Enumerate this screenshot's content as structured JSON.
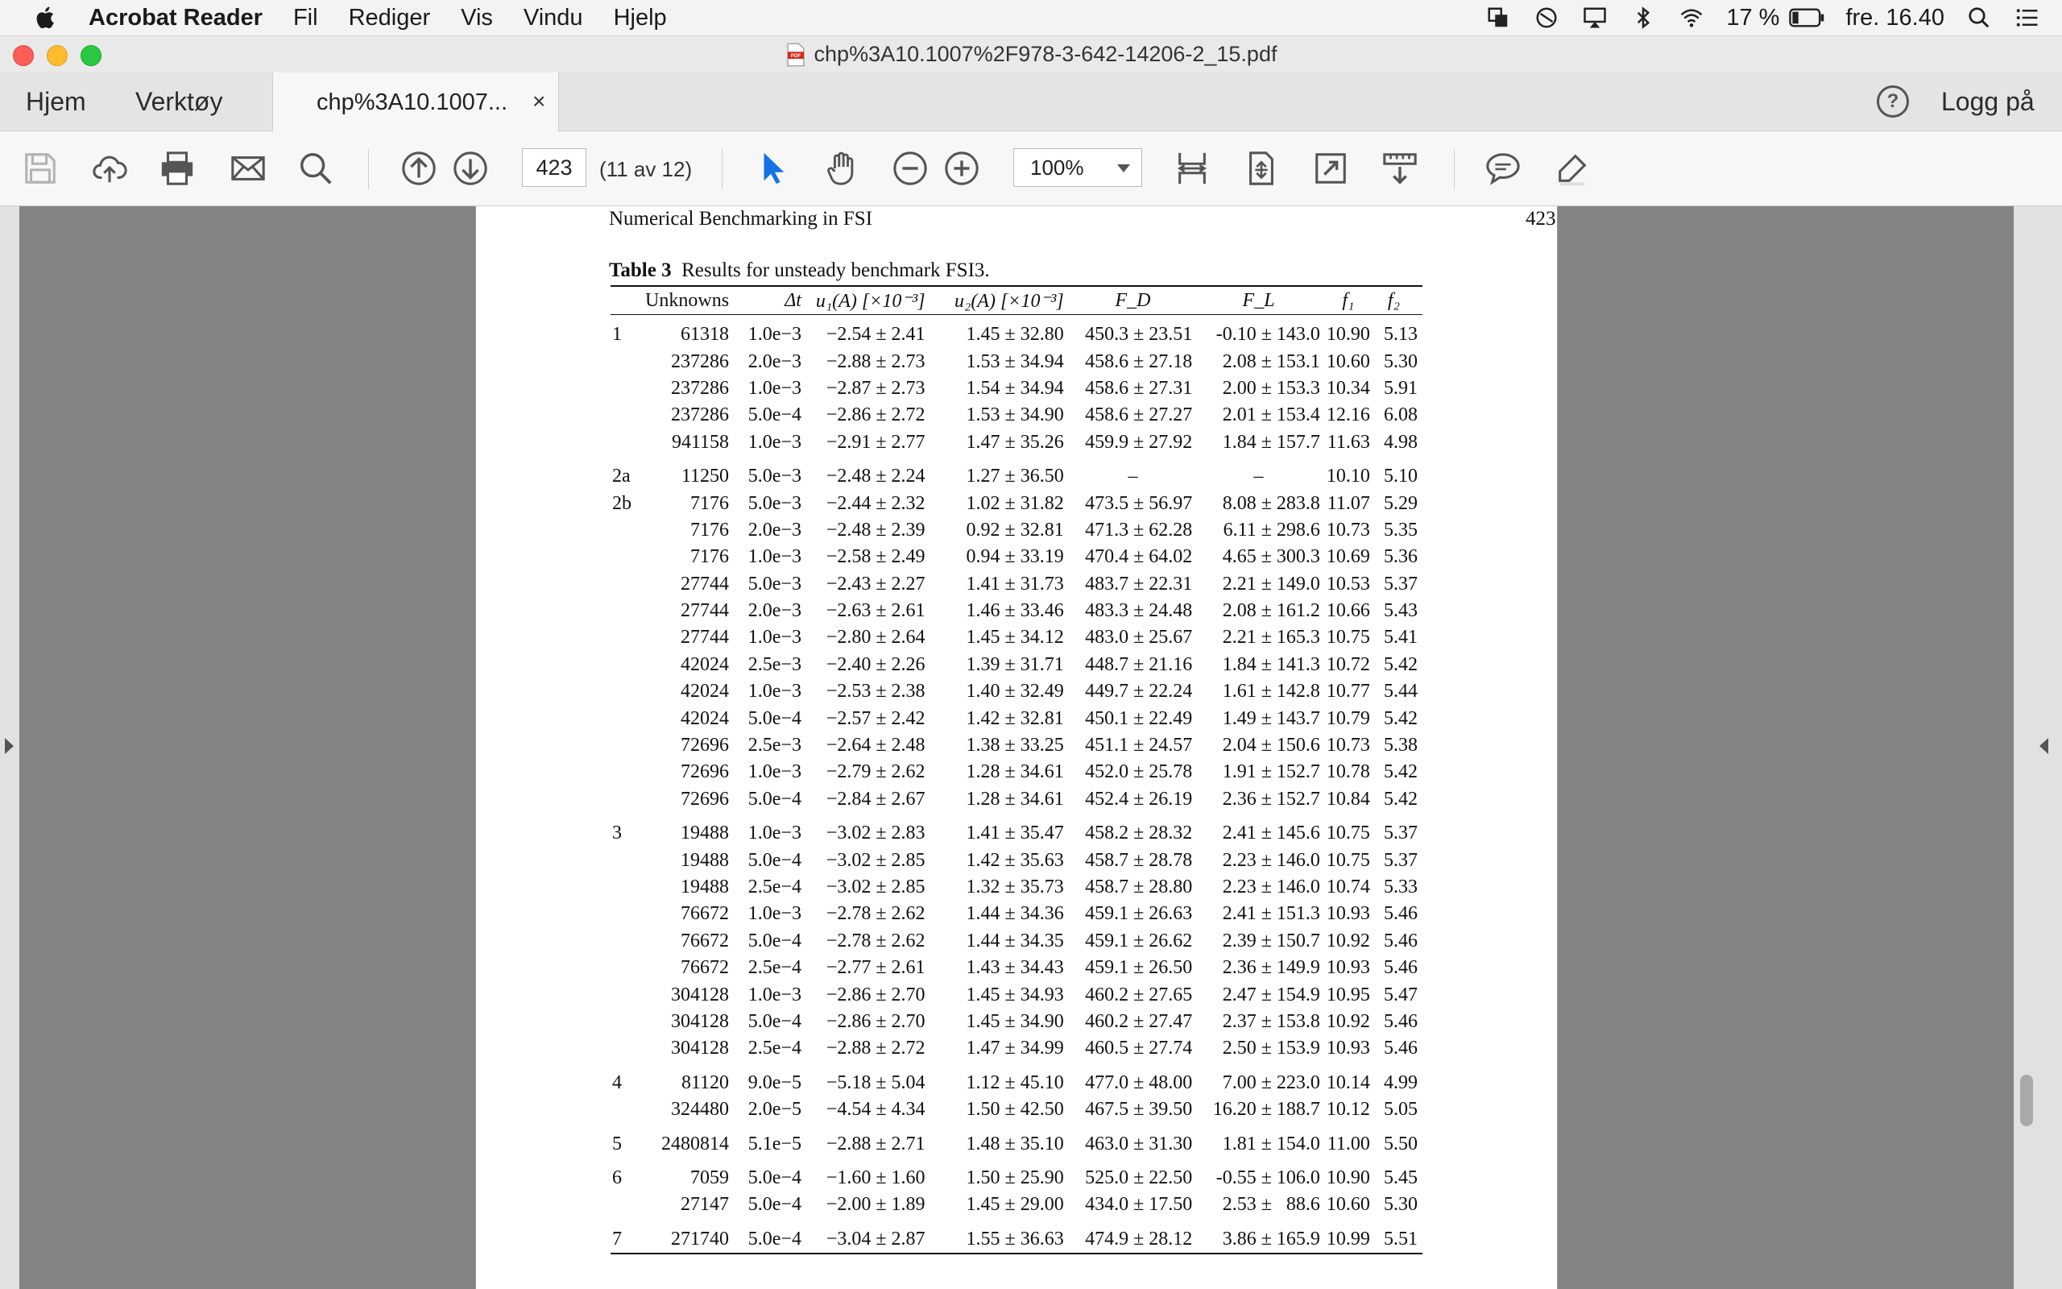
{
  "menubar": {
    "app_name": "Acrobat Reader",
    "menus": [
      "Fil",
      "Rediger",
      "Vis",
      "Vindu",
      "Hjelp"
    ],
    "battery": "17 %",
    "clock": "fre. 16.40"
  },
  "window": {
    "title": "chp%3A10.1007%2F978-3-642-14206-2_15.pdf"
  },
  "tabs": {
    "home": "Hjem",
    "tools": "Verktøy",
    "document": "chp%3A10.1007...",
    "close": "×",
    "help": "?",
    "login": "Logg på"
  },
  "toolbar": {
    "page_number": "423",
    "page_of": "(11 av 12)",
    "zoom": "100%"
  },
  "document": {
    "running_title": "Numerical Benchmarking in FSI",
    "page_number": "423",
    "caption_label": "Table 3",
    "caption_text": "Results for unsteady benchmark FSI3.",
    "headers": {
      "unknowns": "Unknowns",
      "dt": "Δt",
      "u1": "u₁(A) [×10⁻³]",
      "u2": "u₂(A) [×10⁻³]",
      "fd": "F_D",
      "fl": "F_L",
      "f1": "f₁",
      "f2": "f₂"
    },
    "groups": [
      {
        "rows": [
          [
            "1",
            "61318",
            "1.0e−3",
            "−2.54 ± 2.41",
            "1.45 ± 32.80",
            "450.3 ± 23.51",
            "-0.10 ± 143.0",
            "10.90",
            "5.13"
          ],
          [
            "",
            "237286",
            "2.0e−3",
            "−2.88 ± 2.73",
            "1.53 ± 34.94",
            "458.6 ± 27.18",
            "2.08 ± 153.1",
            "10.60",
            "5.30"
          ],
          [
            "",
            "237286",
            "1.0e−3",
            "−2.87 ± 2.73",
            "1.54 ± 34.94",
            "458.6 ± 27.31",
            "2.00 ± 153.3",
            "10.34",
            "5.91"
          ],
          [
            "",
            "237286",
            "5.0e−4",
            "−2.86 ± 2.72",
            "1.53 ± 34.90",
            "458.6 ± 27.27",
            "2.01 ± 153.4",
            "12.16",
            "6.08"
          ],
          [
            "",
            "941158",
            "1.0e−3",
            "−2.91 ± 2.77",
            "1.47 ± 35.26",
            "459.9 ± 27.92",
            "1.84 ± 157.7",
            "11.63",
            "4.98"
          ]
        ]
      },
      {
        "rows": [
          [
            "2a",
            "11250",
            "5.0e−3",
            "−2.48 ± 2.24",
            "1.27 ± 36.50",
            "–",
            "–",
            "10.10",
            "5.10"
          ],
          [
            "2b",
            "7176",
            "5.0e−3",
            "−2.44 ± 2.32",
            "1.02 ± 31.82",
            "473.5 ± 56.97",
            "8.08 ± 283.8",
            "11.07",
            "5.29"
          ],
          [
            "",
            "7176",
            "2.0e−3",
            "−2.48 ± 2.39",
            "0.92 ± 32.81",
            "471.3 ± 62.28",
            "6.11 ± 298.6",
            "10.73",
            "5.35"
          ],
          [
            "",
            "7176",
            "1.0e−3",
            "−2.58 ± 2.49",
            "0.94 ± 33.19",
            "470.4 ± 64.02",
            "4.65 ± 300.3",
            "10.69",
            "5.36"
          ],
          [
            "",
            "27744",
            "5.0e−3",
            "−2.43 ± 2.27",
            "1.41 ± 31.73",
            "483.7 ± 22.31",
            "2.21 ± 149.0",
            "10.53",
            "5.37"
          ],
          [
            "",
            "27744",
            "2.0e−3",
            "−2.63 ± 2.61",
            "1.46 ± 33.46",
            "483.3 ± 24.48",
            "2.08 ± 161.2",
            "10.66",
            "5.43"
          ],
          [
            "",
            "27744",
            "1.0e−3",
            "−2.80 ± 2.64",
            "1.45 ± 34.12",
            "483.0 ± 25.67",
            "2.21 ± 165.3",
            "10.75",
            "5.41"
          ],
          [
            "",
            "42024",
            "2.5e−3",
            "−2.40 ± 2.26",
            "1.39 ± 31.71",
            "448.7 ± 21.16",
            "1.84 ± 141.3",
            "10.72",
            "5.42"
          ],
          [
            "",
            "42024",
            "1.0e−3",
            "−2.53 ± 2.38",
            "1.40 ± 32.49",
            "449.7 ± 22.24",
            "1.61 ± 142.8",
            "10.77",
            "5.44"
          ],
          [
            "",
            "42024",
            "5.0e−4",
            "−2.57 ± 2.42",
            "1.42 ± 32.81",
            "450.1 ± 22.49",
            "1.49 ± 143.7",
            "10.79",
            "5.42"
          ],
          [
            "",
            "72696",
            "2.5e−3",
            "−2.64 ± 2.48",
            "1.38 ± 33.25",
            "451.1 ± 24.57",
            "2.04 ± 150.6",
            "10.73",
            "5.38"
          ],
          [
            "",
            "72696",
            "1.0e−3",
            "−2.79 ± 2.62",
            "1.28 ± 34.61",
            "452.0 ± 25.78",
            "1.91 ± 152.7",
            "10.78",
            "5.42"
          ],
          [
            "",
            "72696",
            "5.0e−4",
            "−2.84 ± 2.67",
            "1.28 ± 34.61",
            "452.4 ± 26.19",
            "2.36 ± 152.7",
            "10.84",
            "5.42"
          ]
        ]
      },
      {
        "rows": [
          [
            "3",
            "19488",
            "1.0e−3",
            "−3.02 ± 2.83",
            "1.41 ± 35.47",
            "458.2 ± 28.32",
            "2.41 ± 145.6",
            "10.75",
            "5.37"
          ],
          [
            "",
            "19488",
            "5.0e−4",
            "−3.02 ± 2.85",
            "1.42 ± 35.63",
            "458.7 ± 28.78",
            "2.23 ± 146.0",
            "10.75",
            "5.37"
          ],
          [
            "",
            "19488",
            "2.5e−4",
            "−3.02 ± 2.85",
            "1.32 ± 35.73",
            "458.7 ± 28.80",
            "2.23 ± 146.0",
            "10.74",
            "5.33"
          ],
          [
            "",
            "76672",
            "1.0e−3",
            "−2.78 ± 2.62",
            "1.44 ± 34.36",
            "459.1 ± 26.63",
            "2.41 ± 151.3",
            "10.93",
            "5.46"
          ],
          [
            "",
            "76672",
            "5.0e−4",
            "−2.78 ± 2.62",
            "1.44 ± 34.35",
            "459.1 ± 26.62",
            "2.39 ± 150.7",
            "10.92",
            "5.46"
          ],
          [
            "",
            "76672",
            "2.5e−4",
            "−2.77 ± 2.61",
            "1.43 ± 34.43",
            "459.1 ± 26.50",
            "2.36 ± 149.9",
            "10.93",
            "5.46"
          ],
          [
            "",
            "304128",
            "1.0e−3",
            "−2.86 ± 2.70",
            "1.45 ± 34.93",
            "460.2 ± 27.65",
            "2.47 ± 154.9",
            "10.95",
            "5.47"
          ],
          [
            "",
            "304128",
            "5.0e−4",
            "−2.86 ± 2.70",
            "1.45 ± 34.90",
            "460.2 ± 27.47",
            "2.37 ± 153.8",
            "10.92",
            "5.46"
          ],
          [
            "",
            "304128",
            "2.5e−4",
            "−2.88 ± 2.72",
            "1.47 ± 34.99",
            "460.5 ± 27.74",
            "2.50 ± 153.9",
            "10.93",
            "5.46"
          ]
        ]
      },
      {
        "rows": [
          [
            "4",
            "81120",
            "9.0e−5",
            "−5.18 ± 5.04",
            "1.12 ± 45.10",
            "477.0 ± 48.00",
            "7.00 ± 223.0",
            "10.14",
            "4.99"
          ],
          [
            "",
            "324480",
            "2.0e−5",
            "−4.54 ± 4.34",
            "1.50 ± 42.50",
            "467.5 ± 39.50",
            "16.20 ± 188.7",
            "10.12",
            "5.05"
          ]
        ]
      },
      {
        "rows": [
          [
            "5",
            "2480814",
            "5.1e−5",
            "−2.88 ± 2.71",
            "1.48 ± 35.10",
            "463.0 ± 31.30",
            "1.81 ± 154.0",
            "11.00",
            "5.50"
          ]
        ]
      },
      {
        "rows": [
          [
            "6",
            "7059",
            "5.0e−4",
            "−1.60 ± 1.60",
            "1.50 ± 25.90",
            "525.0 ± 22.50",
            "-0.55 ± 106.0",
            "10.90",
            "5.45"
          ],
          [
            "",
            "27147",
            "5.0e−4",
            "−2.00 ± 1.89",
            "1.45 ± 29.00",
            "434.0 ± 17.50",
            "2.53 ±   88.6",
            "10.60",
            "5.30"
          ]
        ]
      },
      {
        "rows": [
          [
            "7",
            "271740",
            "5.0e−4",
            "−3.04 ± 2.87",
            "1.55 ± 36.63",
            "474.9 ± 28.12",
            "3.86 ± 165.9",
            "10.99",
            "5.51"
          ]
        ]
      }
    ]
  }
}
